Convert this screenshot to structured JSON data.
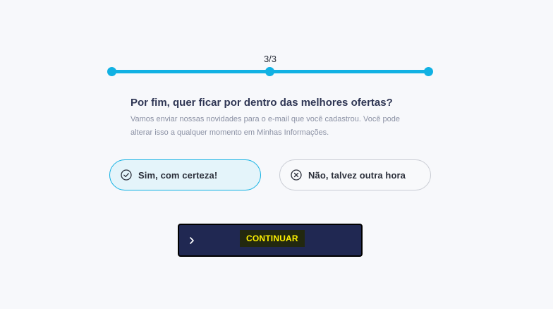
{
  "progress": {
    "label": "3/3",
    "current_step": 3,
    "total_steps": 3,
    "fraction": 1.0,
    "color": "#11b1e3"
  },
  "question": {
    "title": "Por fim, quer ficar por dentro das melhores ofertas?",
    "description": "Vamos enviar nossas novidades para o e-mail que você cadastrou. Você pode alterar isso a qualquer momento em Minhas Informações."
  },
  "options": [
    {
      "label": "Sim, com certeza!",
      "icon": "check-circle-icon",
      "selected": true
    },
    {
      "label": "Não, talvez outra hora",
      "icon": "x-circle-icon",
      "selected": false
    }
  ],
  "continue_button": {
    "label": "CONTINUAR",
    "icon": "chevron-right-icon",
    "background": "#202852",
    "label_color": "#fff200"
  }
}
